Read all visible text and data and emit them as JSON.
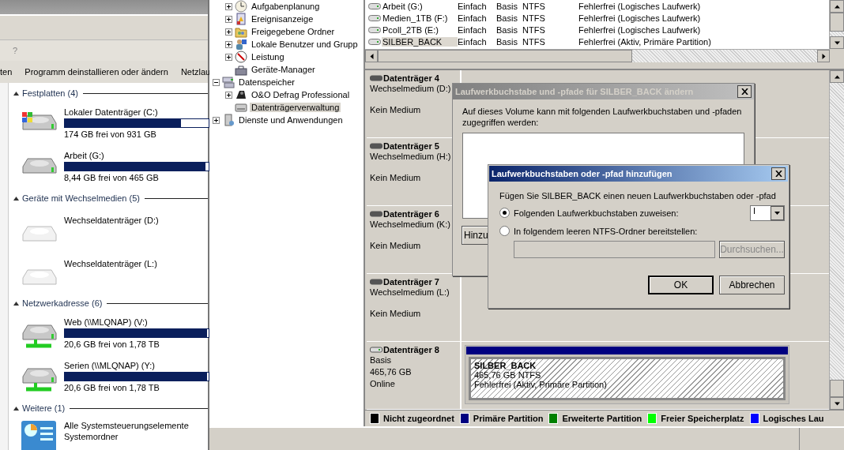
{
  "explorer": {
    "menu": [
      "?"
    ],
    "toolbar": [
      "ten",
      "Programm deinstallieren oder ändern",
      "Netzlau"
    ],
    "groups": [
      {
        "title": "Festplatten (4)",
        "expanded": true,
        "items": [
          {
            "kind": "system_drive",
            "name": "Lokaler Datenträger (C:)",
            "level": 0.81,
            "detail": "174 GB frei von 931 GB"
          },
          {
            "kind": "drive",
            "name": "Arbeit (G:)",
            "level": 0.98,
            "detail": "8,44 GB frei von 465 GB"
          }
        ]
      },
      {
        "title": "Geräte mit Wechselmedien (5)",
        "expanded": true,
        "items": [
          {
            "kind": "removable",
            "name": "Wechseldatenträger (D:)"
          },
          {
            "kind": "removable",
            "name": "Wechseldatenträger (L:)"
          }
        ]
      },
      {
        "title": "Netzwerkadresse (6)",
        "expanded": true,
        "items": [
          {
            "kind": "network",
            "name": "Web (\\\\MLQNAP) (V:)",
            "level": 0.99,
            "detail": "20,6 GB frei von 1,78 TB"
          },
          {
            "kind": "network",
            "name": "Serien (\\\\MLQNAP) (Y:)",
            "level": 0.99,
            "detail": "20,6 GB frei von 1,78 TB"
          }
        ]
      },
      {
        "title": "Weitere (1)",
        "expanded": true,
        "items": [
          {
            "kind": "folder",
            "name": "Alle Systemsteuerungselemente",
            "detail": "Systemordner"
          }
        ]
      }
    ]
  },
  "tree": [
    {
      "children": [
        {
          "label": "Aufgabenplanung",
          "expanded": false,
          "selected": false
        },
        {
          "label": "Ereignisanzeige",
          "expanded": false,
          "selected": false
        },
        {
          "label": "Freigegebene Ordner",
          "expanded": false,
          "selected": false
        },
        {
          "label": "Lokale Benutzer und Grupp",
          "expanded": false,
          "selected": false
        },
        {
          "label": "Leistung",
          "expanded": false,
          "selected": false
        },
        {
          "label": "Geräte-Manager",
          "selected": false
        }
      ]
    },
    {
      "label": "Datenspeicher",
      "expanded": true,
      "selected": false,
      "children": [
        {
          "label": "O&O Defrag Professional",
          "expanded": false,
          "selected": false
        },
        {
          "label": "Datenträgerverwaltung",
          "selected": true
        }
      ]
    },
    {
      "label": "Dienste und Anwendungen",
      "expanded": false,
      "selected": false
    }
  ],
  "volumes": [
    {
      "name": "Arbeit (G:)",
      "layout": "Einfach",
      "type": "Basis",
      "fs": "NTFS",
      "status": "Fehlerfrei (Logisches Laufwerk)",
      "selected": false
    },
    {
      "name": "Medien_1TB (F:)",
      "layout": "Einfach",
      "type": "Basis",
      "fs": "NTFS",
      "status": "Fehlerfrei (Logisches Laufwerk)",
      "selected": false
    },
    {
      "name": "Pcoll_2TB (E:)",
      "layout": "Einfach",
      "type": "Basis",
      "fs": "NTFS",
      "status": "Fehlerfrei (Logisches Laufwerk)",
      "selected": false
    },
    {
      "name": "SILBER_BACK",
      "layout": "Einfach",
      "type": "Basis",
      "fs": "NTFS",
      "status": "Fehlerfrei (Aktiv, Primäre Partition)",
      "selected": true
    }
  ],
  "disks": [
    {
      "kind": "removable",
      "title": "Datenträger 4",
      "medium": "Wechselmedium (D:)",
      "state": "Kein Medium"
    },
    {
      "kind": "removable",
      "title": "Datenträger 5",
      "medium": "Wechselmedium (H:)",
      "state": "Kein Medium"
    },
    {
      "kind": "removable",
      "title": "Datenträger 6",
      "medium": "Wechselmedium (K:)",
      "state": "Kein Medium"
    },
    {
      "kind": "removable",
      "title": "Datenträger 7",
      "medium": "Wechselmedium (L:)",
      "state": "Kein Medium"
    },
    {
      "kind": "basic",
      "title": "Datenträger 8",
      "lines": [
        "Basis",
        "465,76 GB",
        "Online"
      ],
      "partition": {
        "name": "SILBER_BACK",
        "size": "465,76 GB NTFS",
        "status": "Fehlerfrei (Aktiv, Primäre Partition)",
        "color": "#000080",
        "selected": true
      }
    }
  ],
  "legend": [
    {
      "label": "Nicht zugeordnet",
      "color": "#000000"
    },
    {
      "label": "Primäre Partition",
      "color": "#000080"
    },
    {
      "label": "Erweiterte Partition",
      "color": "#008000"
    },
    {
      "label": "Freier Speicherplatz",
      "color": "#00ff00"
    },
    {
      "label": "Logisches Lau",
      "color": "#0000ff"
    }
  ],
  "change_dialog": {
    "title": "Laufwerkbuchstabe und -pfade für SILBER_BACK ändern",
    "text": "Auf dieses Volume kann mit folgenden Laufwerkbuchstaben und -pfaden zugegriffen werden:",
    "button": "Hinzu"
  },
  "add_dialog": {
    "title": "Laufwerkbuchstaben oder -pfad hinzufügen",
    "prompt": "Fügen Sie SILBER_BACK einen neuen Laufwerkbuchstaben oder -pfad",
    "options": [
      {
        "label": "Folgenden Laufwerkbuchstaben zuweisen:",
        "selected": true
      },
      {
        "label": "In folgendem leeren NTFS-Ordner bereitstellen:",
        "selected": false
      }
    ],
    "letter": "I",
    "browse": {
      "label": "Durchsuchen...",
      "disabled": true
    },
    "buttons": [
      {
        "label": "OK",
        "default": true
      },
      {
        "label": "Abbrechen",
        "default": false
      }
    ]
  }
}
